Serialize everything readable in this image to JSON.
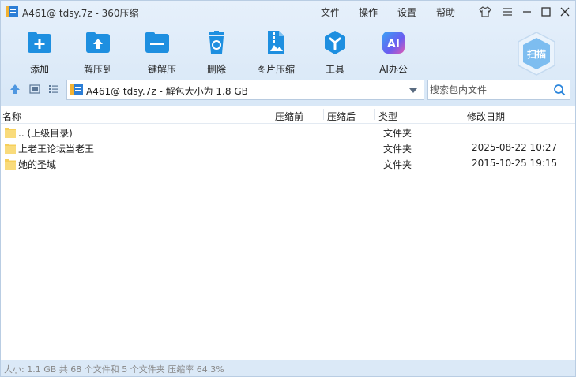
{
  "titlebar": {
    "title": "A461@ tdsy.7z - 360压缩",
    "menu": [
      "文件",
      "操作",
      "设置",
      "帮助"
    ]
  },
  "toolbar": {
    "tools": [
      {
        "label": "添加",
        "icon": "add-icon"
      },
      {
        "label": "解压到",
        "icon": "extract-to-icon"
      },
      {
        "label": "一键解压",
        "icon": "one-click-extract-icon"
      },
      {
        "label": "删除",
        "icon": "recycle-bin-icon"
      },
      {
        "label": "图片压缩",
        "icon": "image-compress-icon"
      },
      {
        "label": "工具",
        "icon": "tools-icon"
      },
      {
        "label": "AI办公",
        "icon": "ai-office-icon"
      }
    ],
    "scan_label": "扫描"
  },
  "address": {
    "path": "A461@ tdsy.7z - 解包大小为 1.8 GB"
  },
  "search": {
    "placeholder": "搜索包内文件"
  },
  "list": {
    "columns": [
      "名称",
      "压缩前",
      "压缩后",
      "类型",
      "修改日期"
    ],
    "rows": [
      {
        "name": ".. (上级目录)",
        "before": "",
        "after": "",
        "type": "文件夹",
        "date": ""
      },
      {
        "name": "上老王论坛当老王",
        "before": "",
        "after": "",
        "type": "文件夹",
        "date": "2025-08-22 10:27"
      },
      {
        "name": "她的圣域",
        "before": "",
        "after": "",
        "type": "文件夹",
        "date": "2015-10-25 19:15"
      }
    ]
  },
  "status": {
    "text": "大小: 1.1 GB 共 68 个文件和 5 个文件夹 压缩率 64.3%"
  },
  "colors": {
    "accent": "#1e8fe0",
    "folder": "#f6cf5a",
    "window_bg": "#dbe9f7"
  }
}
